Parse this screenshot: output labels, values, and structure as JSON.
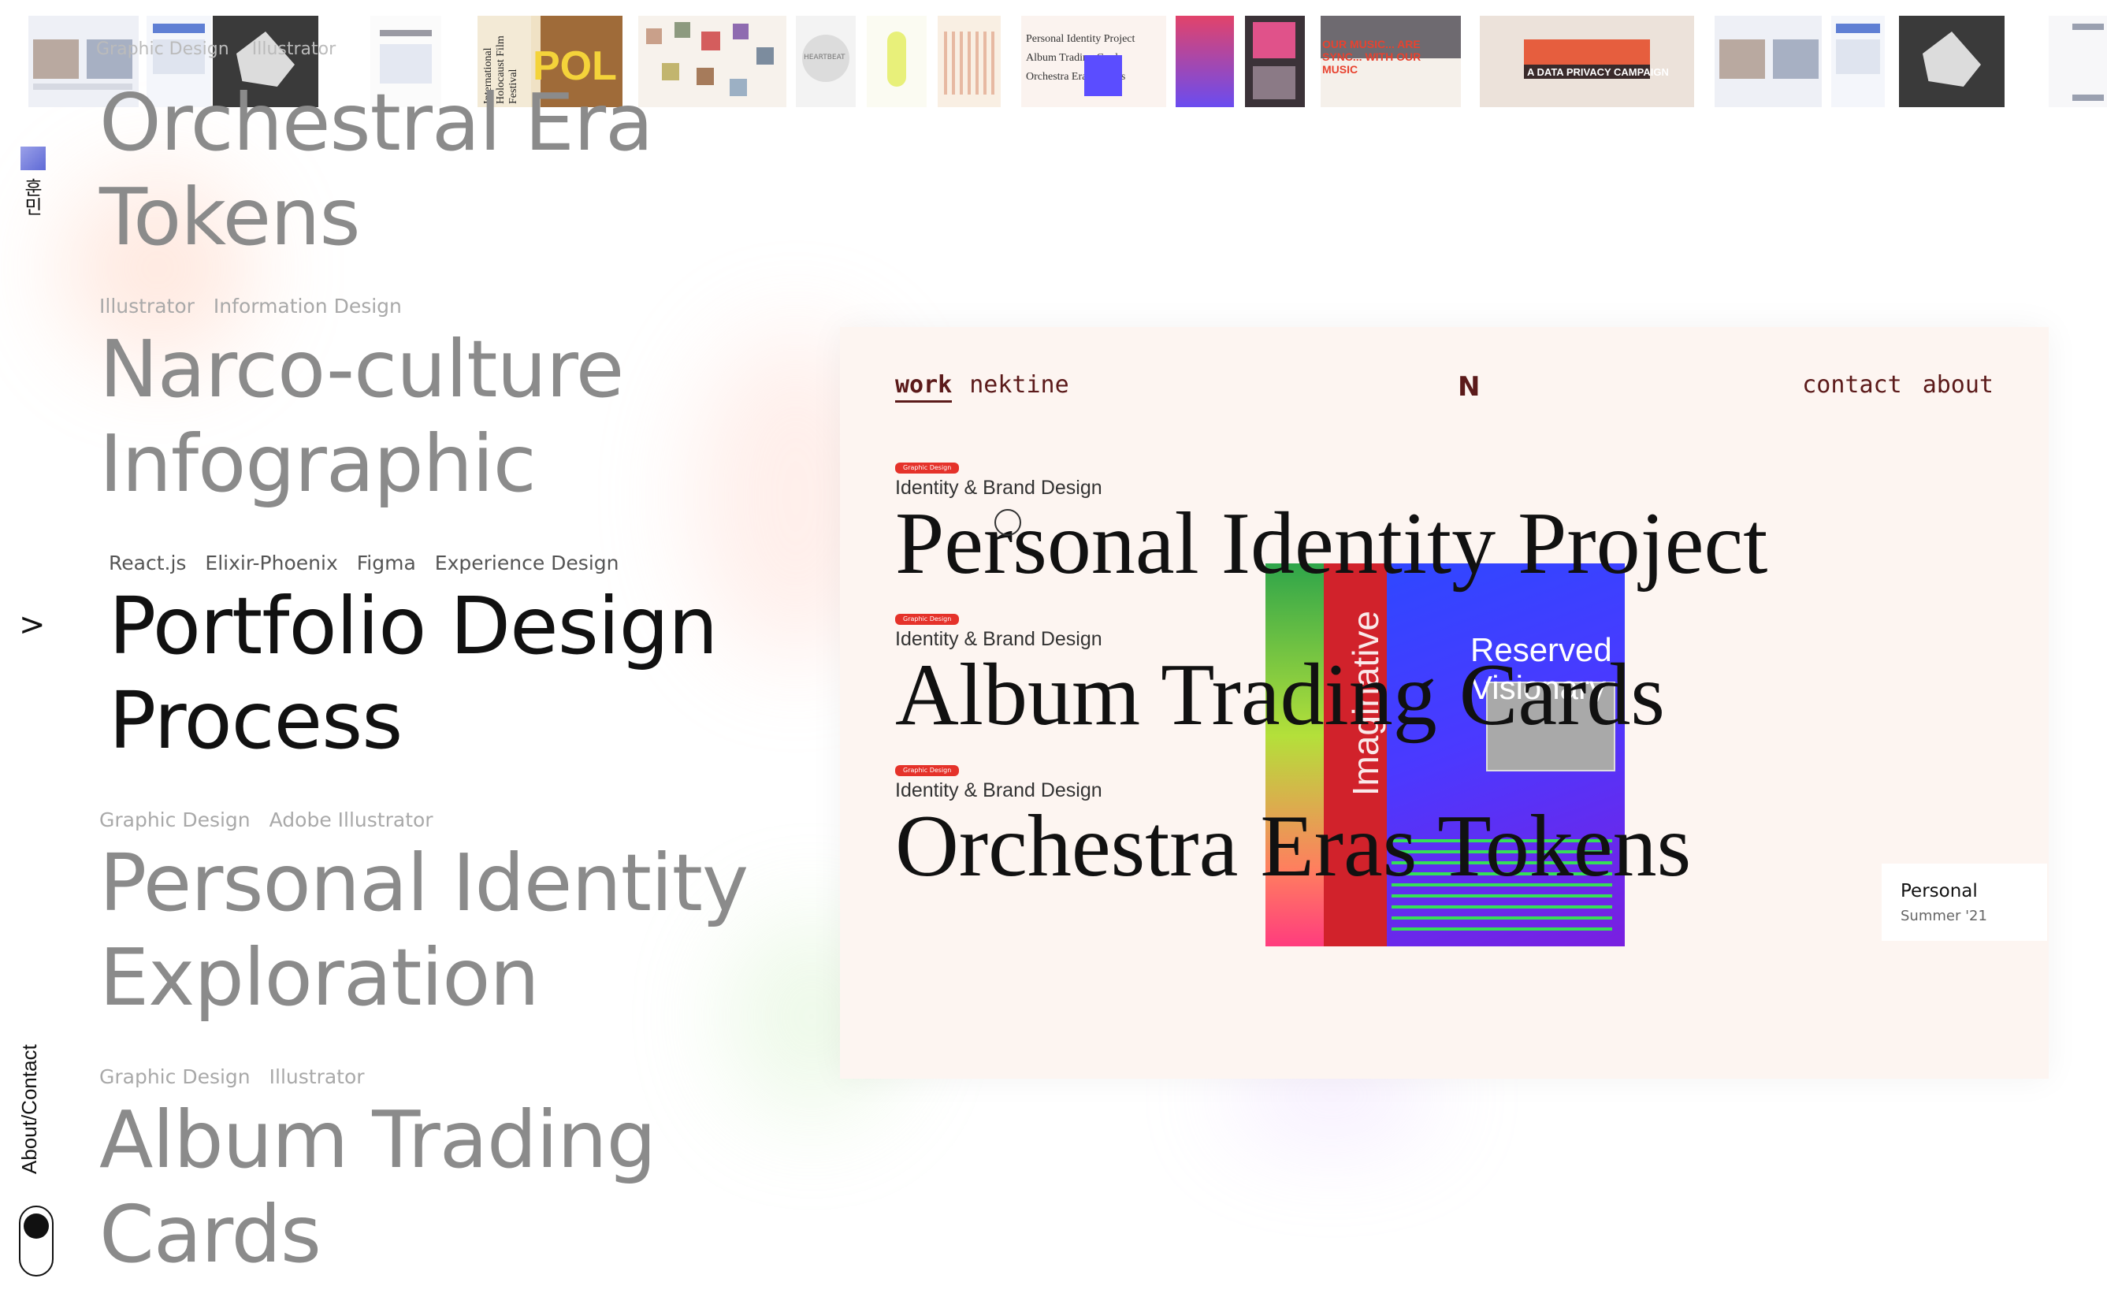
{
  "filmstrip": {
    "tile_texts": [
      "Graphic Design",
      "Illustrator",
      "International Holocaust Film Festival",
      "POL",
      "HEARTBEAT",
      "Personal Identity Project",
      "Album Trading Cards",
      "Orchestra Eras Tokens",
      "OUR MUSIC... ARE SYNC... WITH OUR MUSIC",
      "A DATA PRIVACY CAMPAIGN"
    ]
  },
  "rail": {
    "hangul": "훈민",
    "arrow": ">",
    "about_contact": "About/Contact"
  },
  "projects": [
    {
      "tags": [],
      "title_lines": [
        "Orchestral Era",
        "Tokens"
      ],
      "active": false
    },
    {
      "tags": [
        "Illustrator",
        "Information Design"
      ],
      "title_lines": [
        "Narco-culture",
        "Infographic"
      ],
      "active": false
    },
    {
      "tags": [
        "React.js",
        "Elixir-Phoenix",
        "Figma",
        "Experience Design"
      ],
      "title_lines": [
        "Portfolio Design",
        "Process"
      ],
      "active": true
    },
    {
      "tags": [
        "Graphic Design",
        "Adobe Illustrator"
      ],
      "title_lines": [
        "Personal Identity",
        "Exploration"
      ],
      "active": false
    },
    {
      "tags": [
        "Graphic Design",
        "Illustrator"
      ],
      "title_lines": [
        "Album Trading",
        "Cards"
      ],
      "active": false
    }
  ],
  "preview": {
    "nav": {
      "work": "work",
      "name": "nektine",
      "mark": "N",
      "contact": "contact",
      "about": "about"
    },
    "entries": [
      {
        "badge": "Graphic Design",
        "category": "Identity & Brand Design",
        "title": "Personal Identity Project"
      },
      {
        "badge": "Graphic Design",
        "category": "Identity & Brand Design",
        "title": "Album Trading Cards"
      },
      {
        "badge": "Graphic Design",
        "category": "Identity & Brand Design",
        "title": "Orchestra Eras Tokens"
      }
    ],
    "artwork_text": {
      "vertical": "Imaginative",
      "horizontal": "Reserved Visionary"
    },
    "info_box": {
      "line1": "Personal",
      "line2": "Summer '21"
    }
  },
  "colors": {
    "accent_red": "#e5322a",
    "nav_text": "#5b1a1a",
    "card_bg": "#fdf5f1"
  }
}
